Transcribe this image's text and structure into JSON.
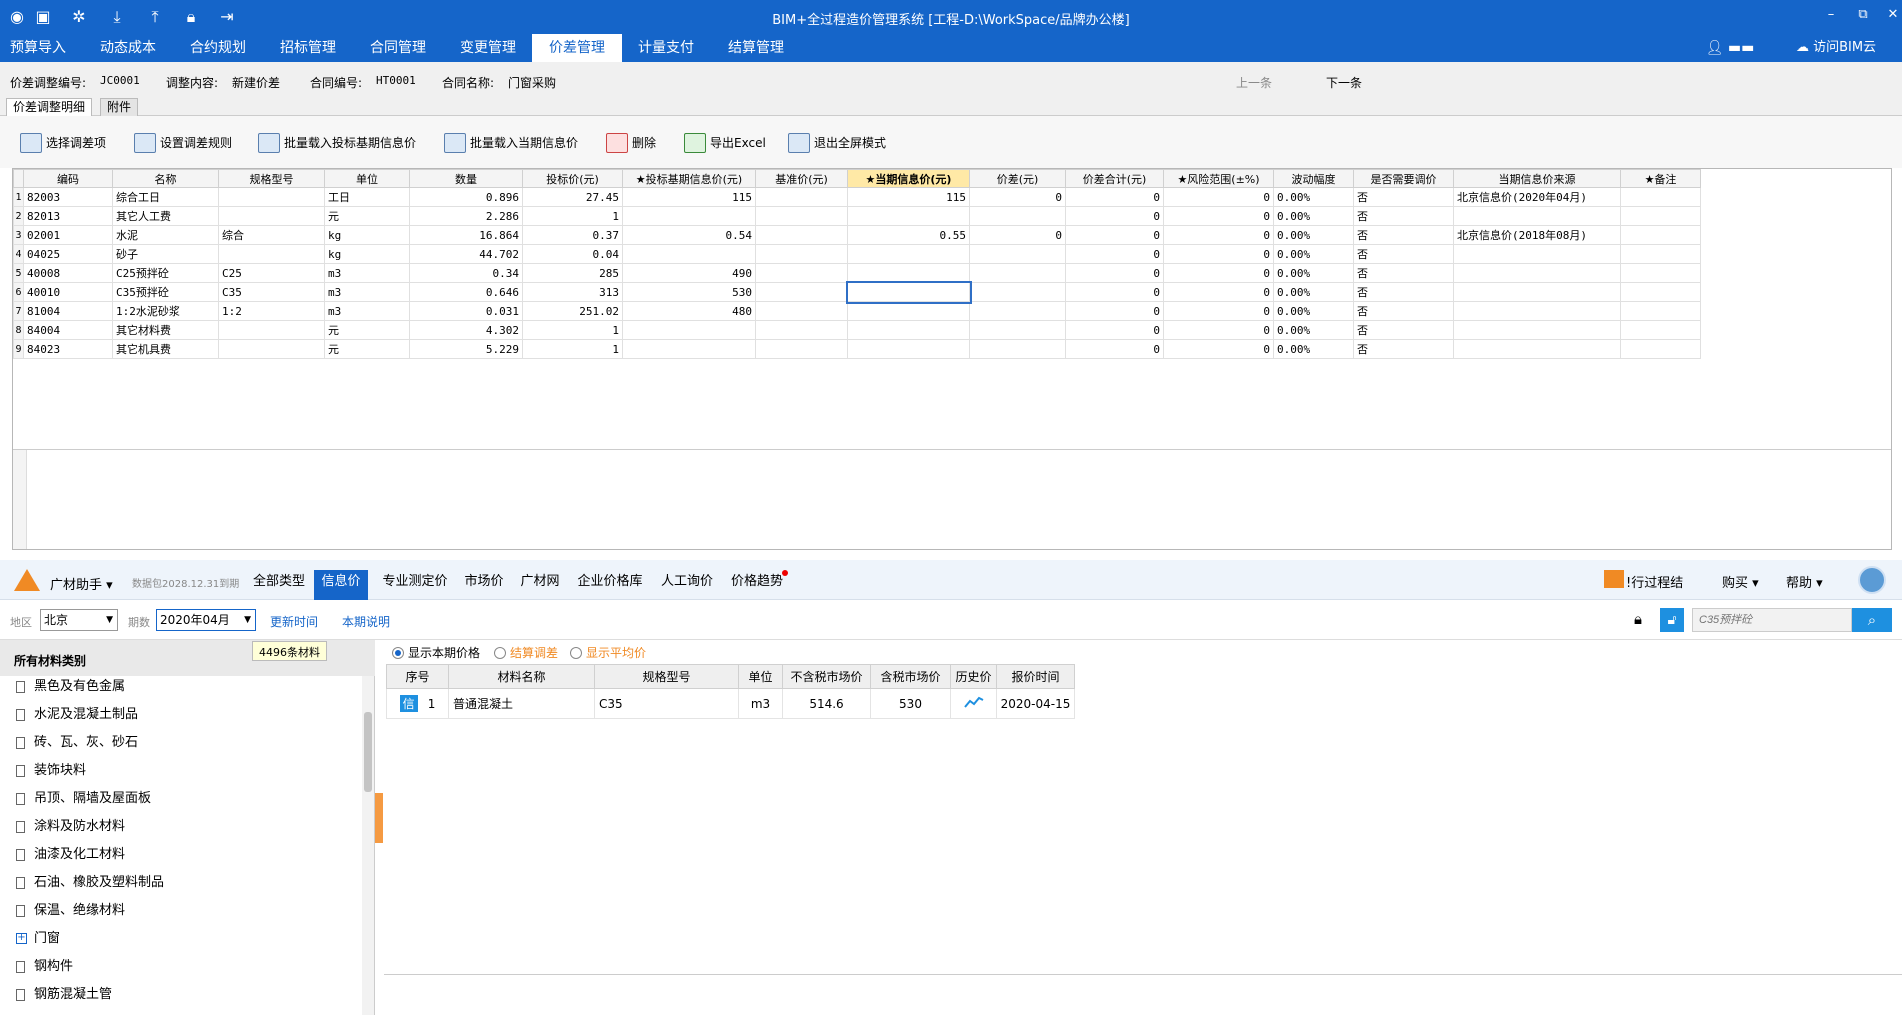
{
  "window": {
    "title": "BIM+全过程造价管理系统 [工程-D:\\WorkSpace/品牌办公楼]",
    "controls": [
      "–",
      "⧉",
      "✕"
    ]
  },
  "quick_icons": [
    "logo-icon",
    "save-icon",
    "settings-icon",
    "download-icon",
    "upload-icon",
    "lock-icon",
    "exit-icon"
  ],
  "menu": {
    "items": [
      "预算导入",
      "动态成本",
      "合约规划",
      "招标管理",
      "合同管理",
      "变更管理",
      "价差管理",
      "计量支付",
      "结算管理"
    ],
    "active": "价差管理",
    "visit_bim": "访问BIM云"
  },
  "info": {
    "adjust_no_label": "价差调整编号:",
    "adjust_no": "JC0001",
    "content_label": "调整内容:",
    "content": "新建价差",
    "contract_no_label": "合同编号:",
    "contract_no": "HT0001",
    "contract_name_label": "合同名称:",
    "contract_name": "门窗采购",
    "prev": "上一条",
    "next": "下一条"
  },
  "subtabs": [
    "价差调整明细",
    "附件"
  ],
  "toolbar": [
    "选择调差项",
    "设置调差规则",
    "批量载入投标基期信息价",
    "批量载入当期信息价",
    "删除",
    "导出Excel",
    "退出全屏模式"
  ],
  "grid": {
    "columns": [
      "编码",
      "名称",
      "规格型号",
      "单位",
      "数量",
      "投标价(元)",
      "★投标基期信息价(元)",
      "基准价(元)",
      "★当期信息价(元)",
      "价差(元)",
      "价差合计(元)",
      "★风险范围(±%)",
      "波动幅度",
      "是否需要调价",
      "当期信息价来源",
      "★备注"
    ],
    "rows": [
      {
        "no": "1",
        "code": "82003",
        "name": "综合工日",
        "spec": "",
        "unit": "工日",
        "qty": "0.896",
        "bid": "27.45",
        "base_info": "115",
        "base": "",
        "cur": "115",
        "diff": "0",
        "diff_total": "0",
        "risk": "0",
        "fluct": "0.00%",
        "need": "否",
        "src": "北京信息价(2020年04月)",
        "remark": ""
      },
      {
        "no": "2",
        "code": "82013",
        "name": "其它人工费",
        "spec": "",
        "unit": "元",
        "qty": "2.286",
        "bid": "1",
        "base_info": "",
        "base": "",
        "cur": "",
        "diff": "",
        "diff_total": "0",
        "risk": "0",
        "fluct": "0.00%",
        "need": "否",
        "src": "",
        "remark": ""
      },
      {
        "no": "3",
        "code": "02001",
        "name": "水泥",
        "spec": "综合",
        "unit": "kg",
        "qty": "16.864",
        "bid": "0.37",
        "base_info": "0.54",
        "base": "",
        "cur": "0.55",
        "diff": "0",
        "diff_total": "0",
        "risk": "0",
        "fluct": "0.00%",
        "need": "否",
        "src": "北京信息价(2018年08月)",
        "remark": ""
      },
      {
        "no": "4",
        "code": "04025",
        "name": "砂子",
        "spec": "",
        "unit": "kg",
        "qty": "44.702",
        "bid": "0.04",
        "base_info": "",
        "base": "",
        "cur": "",
        "diff": "",
        "diff_total": "0",
        "risk": "0",
        "fluct": "0.00%",
        "need": "否",
        "src": "",
        "remark": ""
      },
      {
        "no": "5",
        "code": "40008",
        "name": "C25预拌砼",
        "spec": "C25",
        "unit": "m3",
        "qty": "0.34",
        "bid": "285",
        "base_info": "490",
        "base": "",
        "cur": "",
        "diff": "",
        "diff_total": "0",
        "risk": "0",
        "fluct": "0.00%",
        "need": "否",
        "src": "",
        "remark": ""
      },
      {
        "no": "6",
        "code": "40010",
        "name": "C35预拌砼",
        "spec": "C35",
        "unit": "m3",
        "qty": "0.646",
        "bid": "313",
        "base_info": "530",
        "base": "",
        "cur": "",
        "diff": "",
        "diff_total": "0",
        "risk": "0",
        "fluct": "0.00%",
        "need": "否",
        "src": "",
        "remark": ""
      },
      {
        "no": "7",
        "code": "81004",
        "name": "1:2水泥砂浆",
        "spec": "1:2",
        "unit": "m3",
        "qty": "0.031",
        "bid": "251.02",
        "base_info": "480",
        "base": "",
        "cur": "",
        "diff": "",
        "diff_total": "0",
        "risk": "0",
        "fluct": "0.00%",
        "need": "否",
        "src": "",
        "remark": ""
      },
      {
        "no": "8",
        "code": "84004",
        "name": "其它材料费",
        "spec": "",
        "unit": "元",
        "qty": "4.302",
        "bid": "1",
        "base_info": "",
        "base": "",
        "cur": "",
        "diff": "",
        "diff_total": "0",
        "risk": "0",
        "fluct": "0.00%",
        "need": "否",
        "src": "",
        "remark": ""
      },
      {
        "no": "9",
        "code": "84023",
        "name": "其它机具费",
        "spec": "",
        "unit": "元",
        "qty": "5.229",
        "bid": "1",
        "base_info": "",
        "base": "",
        "cur": "",
        "diff": "",
        "diff_total": "0",
        "risk": "0",
        "fluct": "0.00%",
        "need": "否",
        "src": "",
        "remark": ""
      }
    ]
  },
  "helper": {
    "name": "广材助手",
    "pkg": "数据包2028.12.31到期",
    "tabs": [
      "全部类型",
      "信息价",
      "专业测定价",
      "市场价",
      "广材网",
      "企业价格库",
      "人工询价",
      "价格趋势"
    ],
    "active": "信息价",
    "right_text": "!行过程结",
    "buy": "购买",
    "help": "帮助"
  },
  "filter": {
    "region_label": "地区",
    "region": "北京",
    "period_label": "期数",
    "period": "2020年04月",
    "update": "更新时间",
    "explain": "本期说明",
    "search_placeholder": "C35预拌砼",
    "tooltip": "4496条材料"
  },
  "categories": {
    "header": "所有材料类别",
    "items": [
      "黑色及有色金属",
      "水泥及混凝土制品",
      "砖、瓦、灰、砂石",
      "装饰块料",
      "吊顶、隔墙及屋面板",
      "涂料及防水材料",
      "油漆及化工材料",
      "石油、橡胶及塑料制品",
      "保温、绝缘材料",
      "门窗",
      "钢构件",
      "钢筋混凝土管"
    ]
  },
  "options": [
    "显示本期价格",
    "结算调差",
    "显示平均价"
  ],
  "results": {
    "columns": [
      "序号",
      "材料名称",
      "规格型号",
      "单位",
      "不含税市场价",
      "含税市场价",
      "历史价",
      "报价时间"
    ],
    "rows": [
      {
        "tag": "信",
        "no": "1",
        "name": "普通混凝土",
        "spec": "C35",
        "unit": "m3",
        "price_ex": "514.6",
        "price_in": "530",
        "date": "2020-04-15"
      }
    ]
  }
}
